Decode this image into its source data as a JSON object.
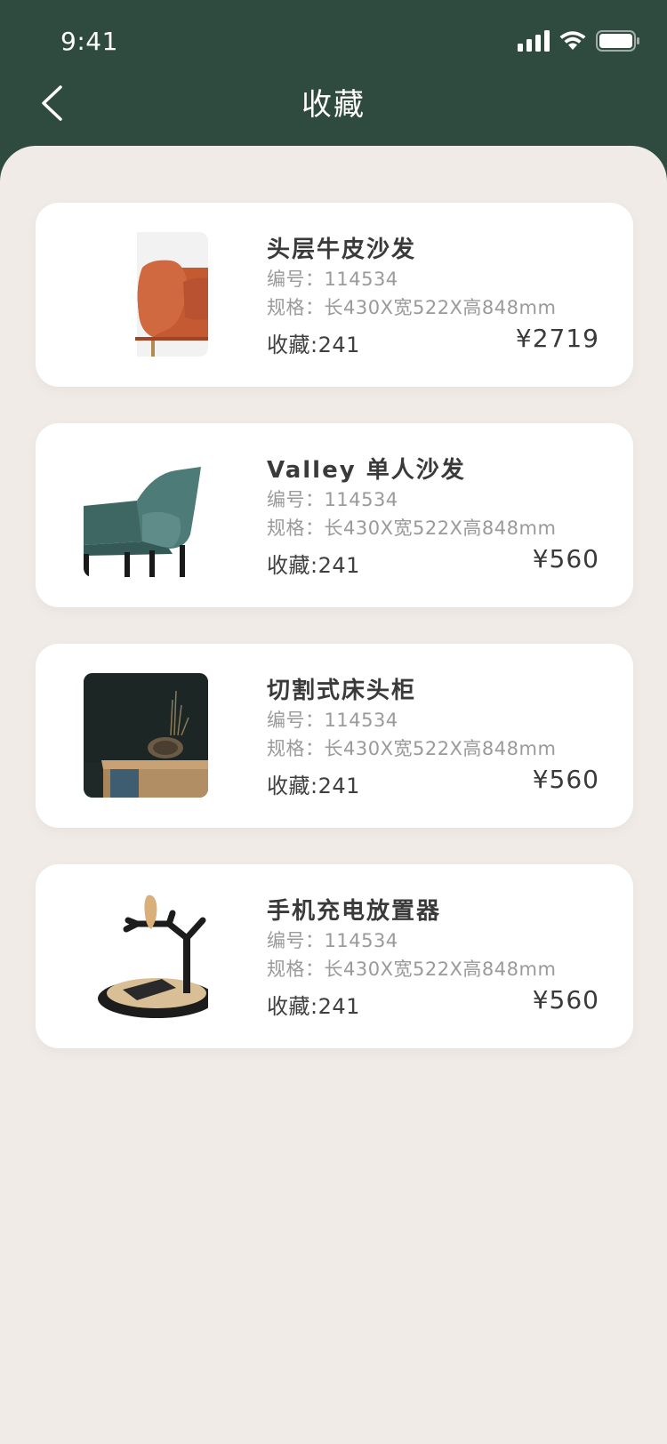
{
  "status_bar": {
    "time": "9:41"
  },
  "nav": {
    "title": "收藏"
  },
  "labels": {
    "code_prefix": "编号：",
    "spec_prefix": "规格：",
    "fav_prefix": "收藏:",
    "currency": "¥"
  },
  "items": [
    {
      "name": "头层牛皮沙发",
      "code": "114534",
      "spec": "长430X宽522X高848mm",
      "favorites": "241",
      "price": "2719",
      "thumb": "orange-leather-sofa-image"
    },
    {
      "name": "Valley 单人沙发",
      "code": "114534",
      "spec": "长430X宽522X高848mm",
      "favorites": "241",
      "price": "560",
      "thumb": "teal-armchair-image"
    },
    {
      "name": "切割式床头柜",
      "code": "114534",
      "spec": "长430X宽522X高848mm",
      "favorites": "241",
      "price": "560",
      "thumb": "wood-nightstand-image"
    },
    {
      "name": "手机充电放置器",
      "code": "114534",
      "spec": "长430X宽522X高848mm",
      "favorites": "241",
      "price": "560",
      "thumb": "bird-charger-stand-image"
    }
  ],
  "colors": {
    "header_bg": "#2f4a3f",
    "content_bg": "#f0ebe7",
    "card_bg": "#ffffff"
  }
}
